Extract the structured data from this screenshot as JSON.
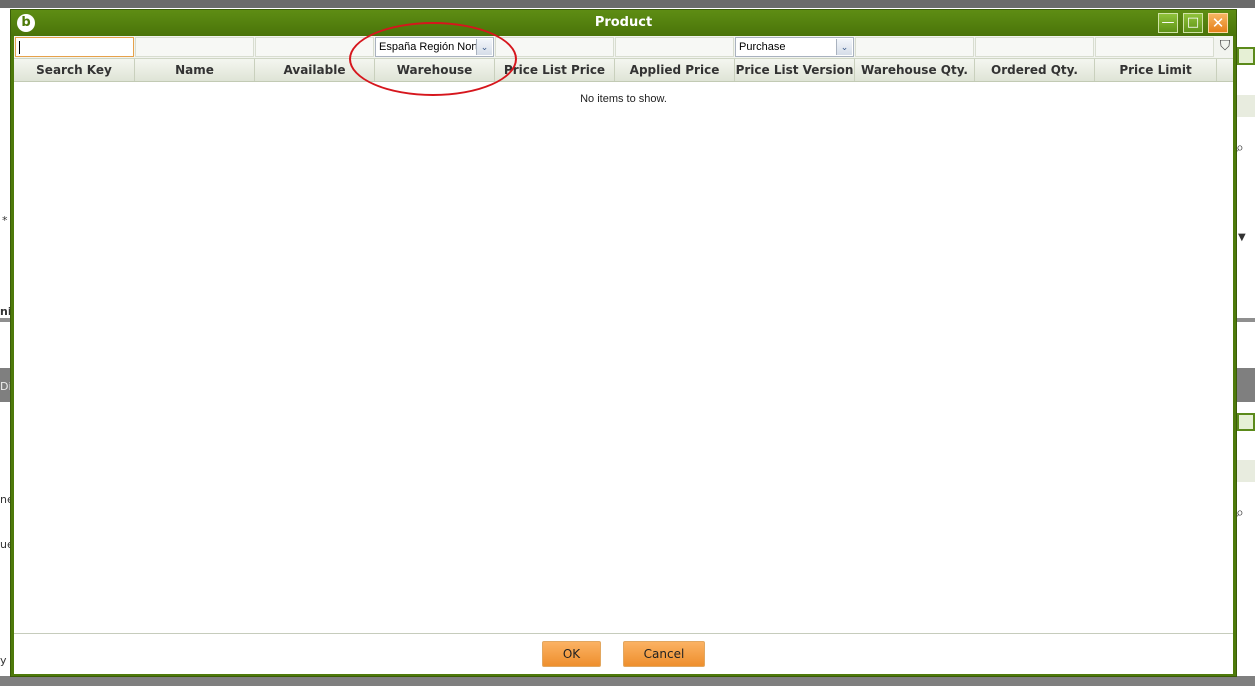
{
  "window": {
    "title": "Product",
    "logo_glyph": "b",
    "minimize_glyph": "—",
    "maximize_glyph": "□",
    "close_glyph": "✕"
  },
  "filters": {
    "warehouse_value": "España Región Norte",
    "price_list_version_value": "Purchase",
    "dropdown_glyph": "⌄",
    "filter_glyph": "⛉"
  },
  "columns": [
    "Search Key",
    "Name",
    "Available",
    "Warehouse",
    "Price List Price",
    "Applied Price",
    "Price List Version",
    "Warehouse Qty.",
    "Ordered Qty.",
    "Price Limit"
  ],
  "empty_message": "No items to show.",
  "buttons": {
    "ok": "OK",
    "cancel": "Cancel"
  },
  "colors": {
    "title_bar": "#4e7a0b",
    "button": "#ee8f2d",
    "annotation": "#d6161d"
  },
  "background_fragments": [
    "*",
    "ni",
    "Dis",
    "ne",
    "ue",
    "y"
  ]
}
